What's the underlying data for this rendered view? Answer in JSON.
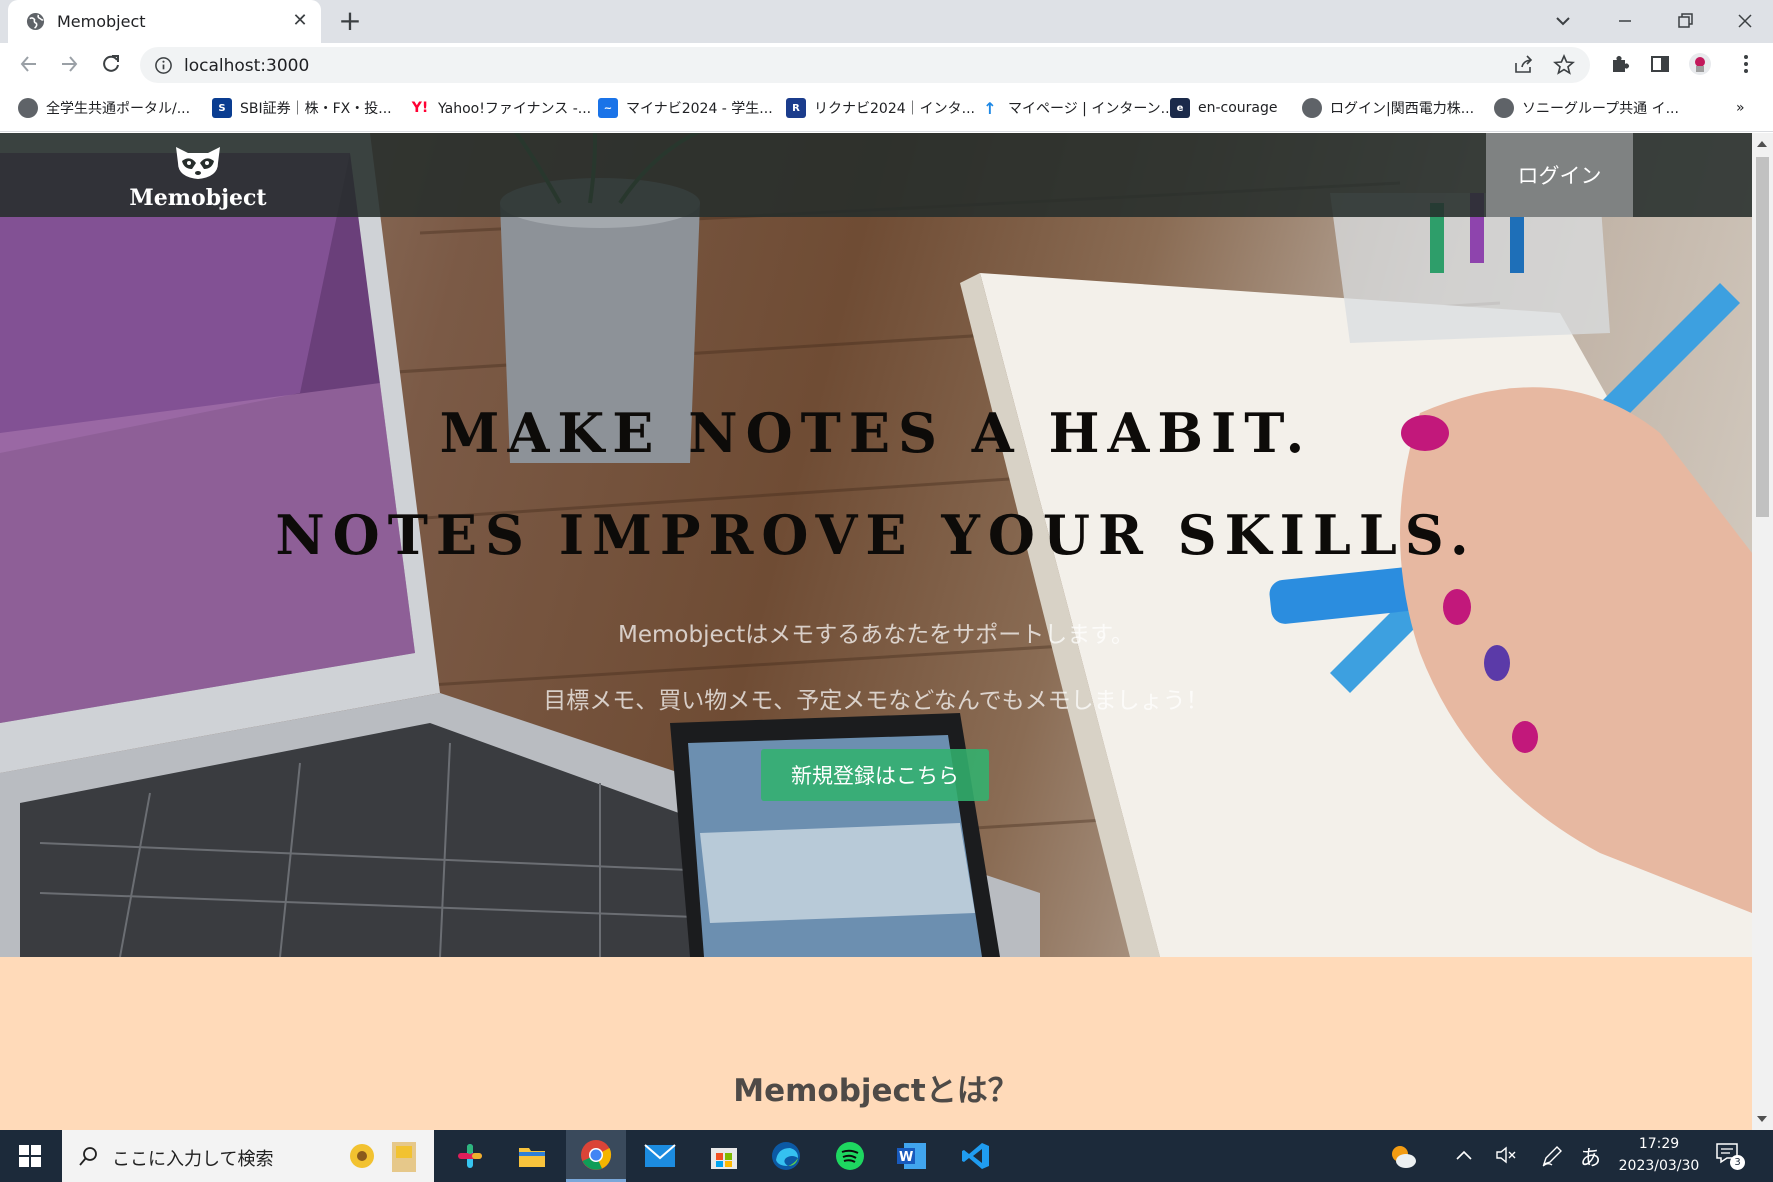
{
  "browser": {
    "tab_title": "Memobject",
    "url": "localhost:3000",
    "bookmarks": [
      {
        "label": "全学生共通ポータル/...",
        "icon": "portal-globe-icon",
        "color": "#5f6368"
      },
      {
        "label": "SBI証券｜株・FX・投...",
        "icon": "sbi-logo-icon",
        "color": "#0a3d91"
      },
      {
        "label": "Yahoo!ファイナンス -...",
        "icon": "yahoo-logo-icon",
        "color": "#ff0033"
      },
      {
        "label": "マイナビ2024 - 学生...",
        "icon": "mynavi-logo-icon",
        "color": "#1a73e8"
      },
      {
        "label": "リクナビ2024｜インタ...",
        "icon": "rikunabi-logo-icon",
        "color": "#1b3c8c"
      },
      {
        "label": "マイページ | インターン...",
        "icon": "mypage-logo-icon",
        "color": "#1e88e5"
      },
      {
        "label": "en-courage",
        "icon": "en-courage-logo-icon",
        "color": "#1b2a4a"
      },
      {
        "label": "ログイン|関西電力株...",
        "icon": "kepco-globe-icon",
        "color": "#5f6368"
      },
      {
        "label": "ソニーグループ共通 イ...",
        "icon": "sony-globe-icon",
        "color": "#5f6368"
      }
    ]
  },
  "site": {
    "logo_text": "Memobject",
    "login_label": "ログイン",
    "headline_1": "MAKE NOTES A HABIT.",
    "headline_2": "NOTES IMPROVE YOUR SKILLS.",
    "sub_1": "Memobjectはメモするあなたをサポートします。",
    "sub_2": "目標メモ、買い物メモ、予定メモなどなんでもメモしましょう！",
    "signup_label": "新規登録はこちら",
    "about_title": "Memobjectとは？",
    "colors": {
      "header_bg": "#262d2b",
      "login_bg": "#7f8282",
      "signup_bg": "#32b26e",
      "about_bg": "#ffdab9"
    }
  },
  "taskbar": {
    "search_placeholder": "ここに入力して検索",
    "apps": [
      "slack-icon",
      "file-explorer-icon",
      "chrome-icon",
      "mail-icon",
      "store-icon",
      "edge-icon",
      "spotify-icon",
      "word-icon",
      "vscode-icon"
    ],
    "ime": "あ",
    "time": "17:29",
    "date": "2023/03/30",
    "notifications": "3"
  }
}
